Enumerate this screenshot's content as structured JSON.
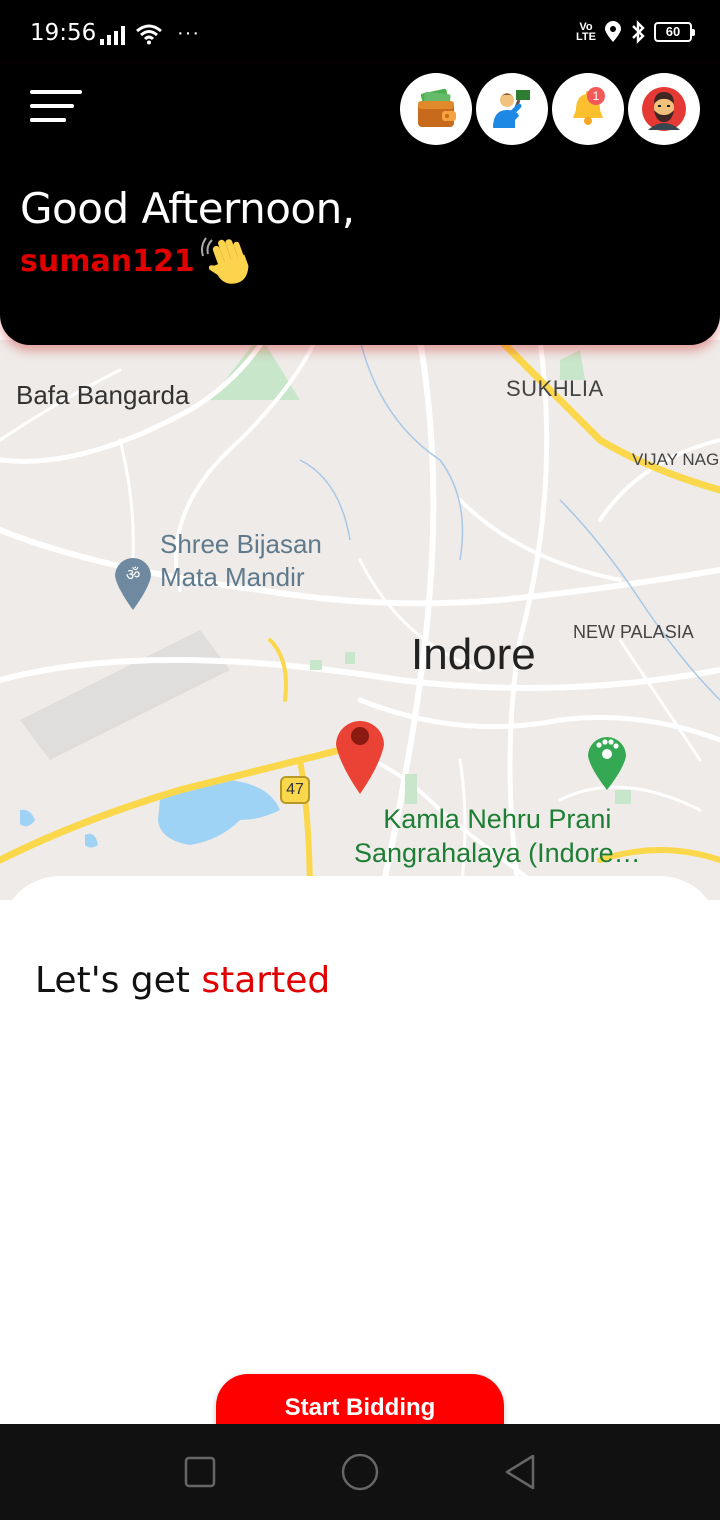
{
  "status_bar": {
    "time": "19:56",
    "dots": "···",
    "network": "VoLTE",
    "battery": "60"
  },
  "header": {
    "greeting": "Good Afternoon,",
    "username": "suman121",
    "notification_count": "1",
    "icons": [
      "menu-icon",
      "wallet-icon",
      "bidder-icon",
      "notification-bell-icon",
      "profile-avatar-icon"
    ]
  },
  "map": {
    "labels": {
      "bafa": "Bafa Bangarda",
      "sukhlia": "SUKHLIA",
      "vijay": "VIJAY NAG",
      "temple_line1": "Shree Bijasan",
      "temple_line2": "Mata Mandir",
      "new_palasia": "NEW PALASIA",
      "city": "Indore",
      "zoo_line1": "Kamla Nehru Prani",
      "zoo_line2": "Sangrahalaya (Indore…",
      "road_shield": "47"
    },
    "colors": {
      "pin": "#ea4335",
      "park": "#c8e6c9",
      "water": "#9fd3f5",
      "highway": "#fbd84b"
    }
  },
  "sheet": {
    "title_prefix": "Let's get ",
    "title_accent": "started",
    "start_button": "Start Bidding"
  },
  "colors": {
    "accent": "#e00000",
    "header_bg": "#000000"
  }
}
